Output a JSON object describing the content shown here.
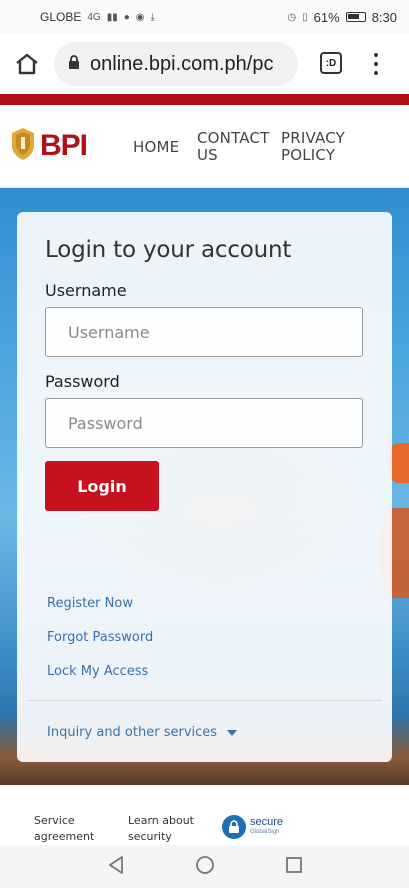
{
  "status_bar": {
    "carrier": "GLOBE",
    "network": "4G",
    "battery": "61%",
    "time": "8:30"
  },
  "browser": {
    "url": "online.bpi.com.ph/pc",
    "tab_label": ":D"
  },
  "header": {
    "logo_text": "BPI",
    "nav": [
      {
        "line1": "HOME",
        "line2": ""
      },
      {
        "line1": "CONTACT",
        "line2": "US"
      },
      {
        "line1": "PRIVACY",
        "line2": "POLICY"
      }
    ]
  },
  "login": {
    "title": "Login to your account",
    "username_label": "Username",
    "username_placeholder": "Username",
    "username_value": "",
    "password_label": "Password",
    "password_placeholder": "Password",
    "password_value": "",
    "login_button": "Login",
    "links": [
      "Register Now",
      "Forgot Password",
      "Lock My Access"
    ],
    "inquiry": "Inquiry and other services"
  },
  "footer": {
    "service_agreement": {
      "line1": "Service",
      "line2": "agreement"
    },
    "learn_security": {
      "line1": "Learn about",
      "line2": "security"
    },
    "secure_badge": {
      "title": "secure",
      "sub": "GlobalSign"
    }
  },
  "colors": {
    "brand_red": "#b30f18",
    "button_red": "#c8101e",
    "link_blue": "#3b73a8"
  }
}
